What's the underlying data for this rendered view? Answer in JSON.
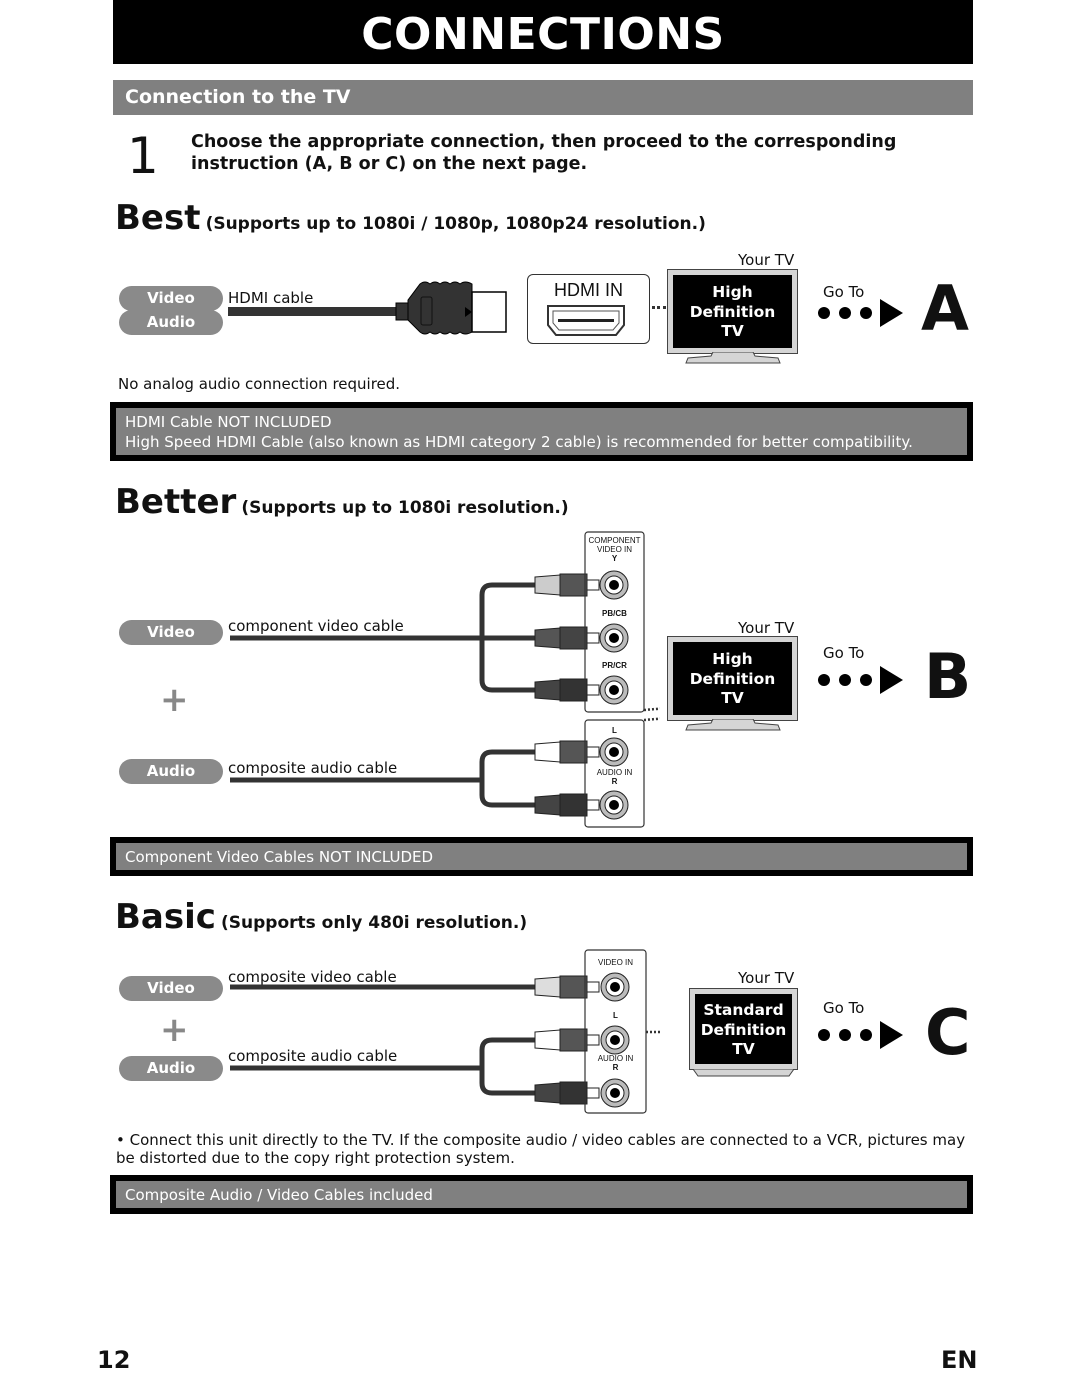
{
  "header": {
    "title": "CONNECTIONS"
  },
  "section": {
    "title": "Connection to the TV"
  },
  "step": {
    "number": "1",
    "text": "Choose the appropriate connection, then proceed to the corresponding instruction (A, B or C) on the next page."
  },
  "best": {
    "tier": "Best",
    "subtitle": "(Supports up to 1080i / 1080p, 1080p24 resolution.)",
    "pills": [
      "Video",
      "Audio"
    ],
    "cable_label": "HDMI cable",
    "port_label": "HDMI IN",
    "your_tv": "Your TV",
    "tv_lines": [
      "High",
      "Definition",
      "TV"
    ],
    "goto": "Go To",
    "letter": "A",
    "note": "No analog audio connection required.",
    "box_lines": [
      "HDMI Cable NOT INCLUDED",
      "High Speed HDMI Cable (also known as HDMI category 2 cable) is recommended for better compatibility."
    ]
  },
  "better": {
    "tier": "Better",
    "subtitle": "(Supports up to 1080i resolution.)",
    "video_pill": "Video",
    "audio_pill": "Audio",
    "plus": "+",
    "video_cable": "component video cable",
    "audio_cable": "composite audio cable",
    "panel_title_1": "COMPONENT",
    "panel_title_2": "VIDEO IN",
    "jack_y": "Y",
    "jack_pb": "PB/CB",
    "jack_pr": "PR/CR",
    "jack_l": "L",
    "audio_in": "AUDIO IN",
    "jack_r": "R",
    "your_tv": "Your TV",
    "tv_lines": [
      "High",
      "Definition",
      "TV"
    ],
    "goto": "Go To",
    "letter": "B",
    "box_lines": [
      "Component Video Cables NOT INCLUDED"
    ]
  },
  "basic": {
    "tier": "Basic",
    "subtitle": "(Supports only 480i resolution.)",
    "video_pill": "Video",
    "audio_pill": "Audio",
    "plus": "+",
    "video_cable": "composite video cable",
    "audio_cable": "composite audio cable",
    "video_in": "VIDEO IN",
    "jack_l": "L",
    "audio_in": "AUDIO IN",
    "jack_r": "R",
    "your_tv": "Your TV",
    "tv_lines": [
      "Standard",
      "Definition",
      "TV"
    ],
    "goto": "Go To",
    "letter": "C",
    "bullet": "• Connect this unit directly to the TV. If the composite audio / video cables are connected to a VCR, pictures may be distorted due to the copy right protection system.",
    "box_lines": [
      "Composite Audio / Video Cables included"
    ]
  },
  "footer": {
    "page": "12",
    "lang": "EN"
  }
}
